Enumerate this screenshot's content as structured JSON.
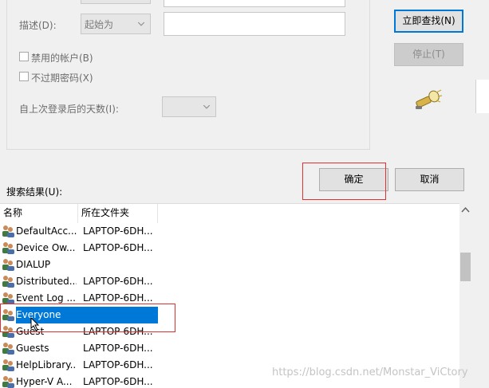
{
  "form": {
    "description_label": "描述(D):",
    "description_combo": "起始为",
    "disabled_accounts_label": "禁用的帐户(B)",
    "no_expire_password_label": "不过期密码(X)",
    "days_since_logon_label": "自上次登录后的天数(I):"
  },
  "buttons": {
    "find_now": "立即查找(N)",
    "stop": "停止(T)",
    "ok": "确定",
    "cancel": "取消"
  },
  "results": {
    "label": "搜索结果(U):",
    "columns": [
      "名称",
      "所在文件夹"
    ],
    "rows": [
      {
        "name": "DefaultAcc...",
        "folder": "LAPTOP-6DH..."
      },
      {
        "name": "Device Ow...",
        "folder": "LAPTOP-6DH..."
      },
      {
        "name": "DIALUP",
        "folder": ""
      },
      {
        "name": "Distributed...",
        "folder": "LAPTOP-6DH..."
      },
      {
        "name": "Event Log ...",
        "folder": "LAPTOP-6DH..."
      },
      {
        "name": "Everyone",
        "folder": "",
        "selected": true
      },
      {
        "name": "Guest",
        "folder": "LAPTOP-6DH..."
      },
      {
        "name": "Guests",
        "folder": "LAPTOP-6DH..."
      },
      {
        "name": "HelpLibrary...",
        "folder": "LAPTOP-6DH..."
      },
      {
        "name": "Hyper-V A...",
        "folder": "LAPTOP-6DH..."
      }
    ]
  },
  "watermark": "https://blog.csdn.net/Monstar_ViCtory",
  "colors": {
    "selection": "#0078d7",
    "highlight_box": "#e03030"
  }
}
